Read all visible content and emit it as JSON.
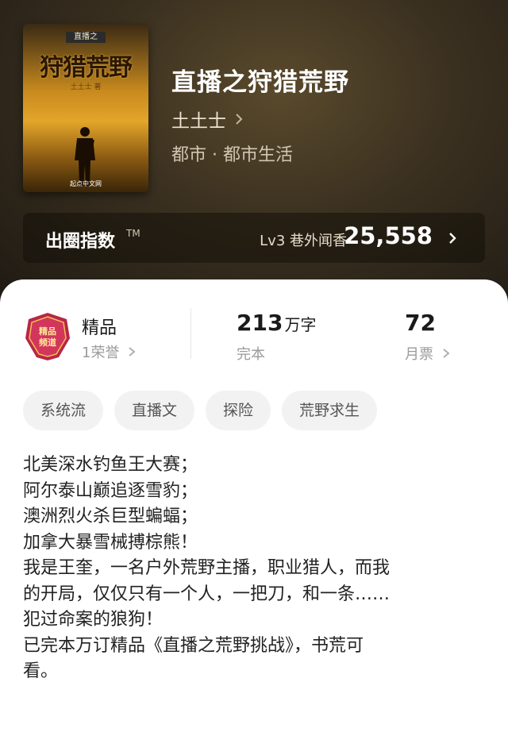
{
  "book": {
    "cover": {
      "tag": "直播之",
      "title": "狩猎荒野",
      "subtitle": "土土士 著",
      "publisher": "起点中文网"
    },
    "title": "直播之狩猎荒野",
    "author": "土土士",
    "genre": "都市 · 都市生活"
  },
  "index_bar": {
    "label": "出圈指数",
    "tm": "TM",
    "level": "Lv3 巷外闻香",
    "value": "25,558"
  },
  "stats": {
    "badge_text": "精品频道",
    "quality_label": "精品",
    "honor": "1荣誉",
    "words_num": "213",
    "words_unit": "万字",
    "status": "完本",
    "monthly_tickets": "72",
    "tickets_label": "月票"
  },
  "tags": [
    "系统流",
    "直播文",
    "探险",
    "荒野求生"
  ],
  "synopsis": [
    "北美深水钓鱼王大赛；",
    "阿尔泰山巅追逐雪豹；",
    "澳洲烈火杀巨型蝙蝠；",
    "加拿大暴雪械搏棕熊！",
    "我是王奎，一名户外荒野主播，职业猎人，而我",
    "的开局，仅仅只有一个人，一把刀，和一条……",
    "犯过命案的狼狗！",
    "已完本万订精品《直播之荒野挑战》，书荒可",
    "看。"
  ],
  "colors": {
    "header_bg": "#3a3020",
    "panel_bg": "#ffffff",
    "tag_bg": "#f2f2f2",
    "badge": "#b8264a"
  },
  "icons": [
    "chevron-right-icon",
    "honor-badge-icon"
  ]
}
